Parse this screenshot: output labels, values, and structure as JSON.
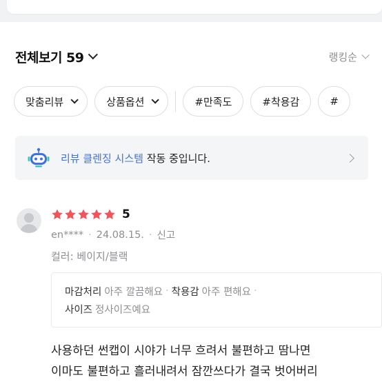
{
  "header": {
    "title": "전체보기 59",
    "sort_label": "랭킹순"
  },
  "filters": {
    "chips": [
      {
        "label": "맞춤리뷰",
        "dropdown": true
      },
      {
        "label": "상품옵션",
        "dropdown": true
      },
      {
        "label": "#만족도",
        "dropdown": false
      },
      {
        "label": "#착용감",
        "dropdown": false
      },
      {
        "label": "#",
        "dropdown": false
      }
    ]
  },
  "notice": {
    "highlight": "리뷰 클렌징 시스템",
    "text": " 작동 중입니다.",
    "icon": "robot-icon",
    "accent_color": "#3f71e3"
  },
  "review": {
    "rating": 5,
    "score_label": "5",
    "star_color": "#f2545b",
    "user": "en****",
    "date": "24.08.15.",
    "report_label": "신고",
    "option": "컬러: 베이지/블랙",
    "survey": [
      {
        "key": "마감처리",
        "value": "아주 깔끔해요"
      },
      {
        "key": "착용감",
        "value": "아주 편해요"
      },
      {
        "key": "사이즈",
        "value": "정사이즈예요"
      }
    ],
    "content_lines": [
      "사용하던 썬캡이 시야가 너무 흐려서 불편하고 땀나면",
      "이마도 불편하고 흘러내려서 잠깐쓰다가 결국 벗어버리"
    ]
  }
}
